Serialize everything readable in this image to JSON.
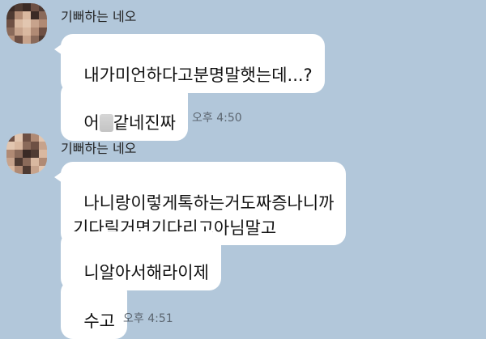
{
  "chat": {
    "groups": [
      {
        "sender": "기뻐하는 네오",
        "messages": [
          {
            "text": "내가미언하다고분명말햇는데...?"
          },
          {
            "before": "어",
            "after": "같네진짜",
            "time": "오후 4:50"
          }
        ]
      },
      {
        "sender": "기뻐하는 네오",
        "messages": [
          {
            "text": "나니랑이렇게톡하는거도짜증나니까\n기다릴거면기다리고아님말고"
          },
          {
            "text": "니알아서해라이제"
          },
          {
            "text": "수고",
            "time": "오후 4:51"
          }
        ]
      }
    ]
  },
  "colors": {
    "background": "#b2c7da",
    "bubble": "#ffffff"
  }
}
